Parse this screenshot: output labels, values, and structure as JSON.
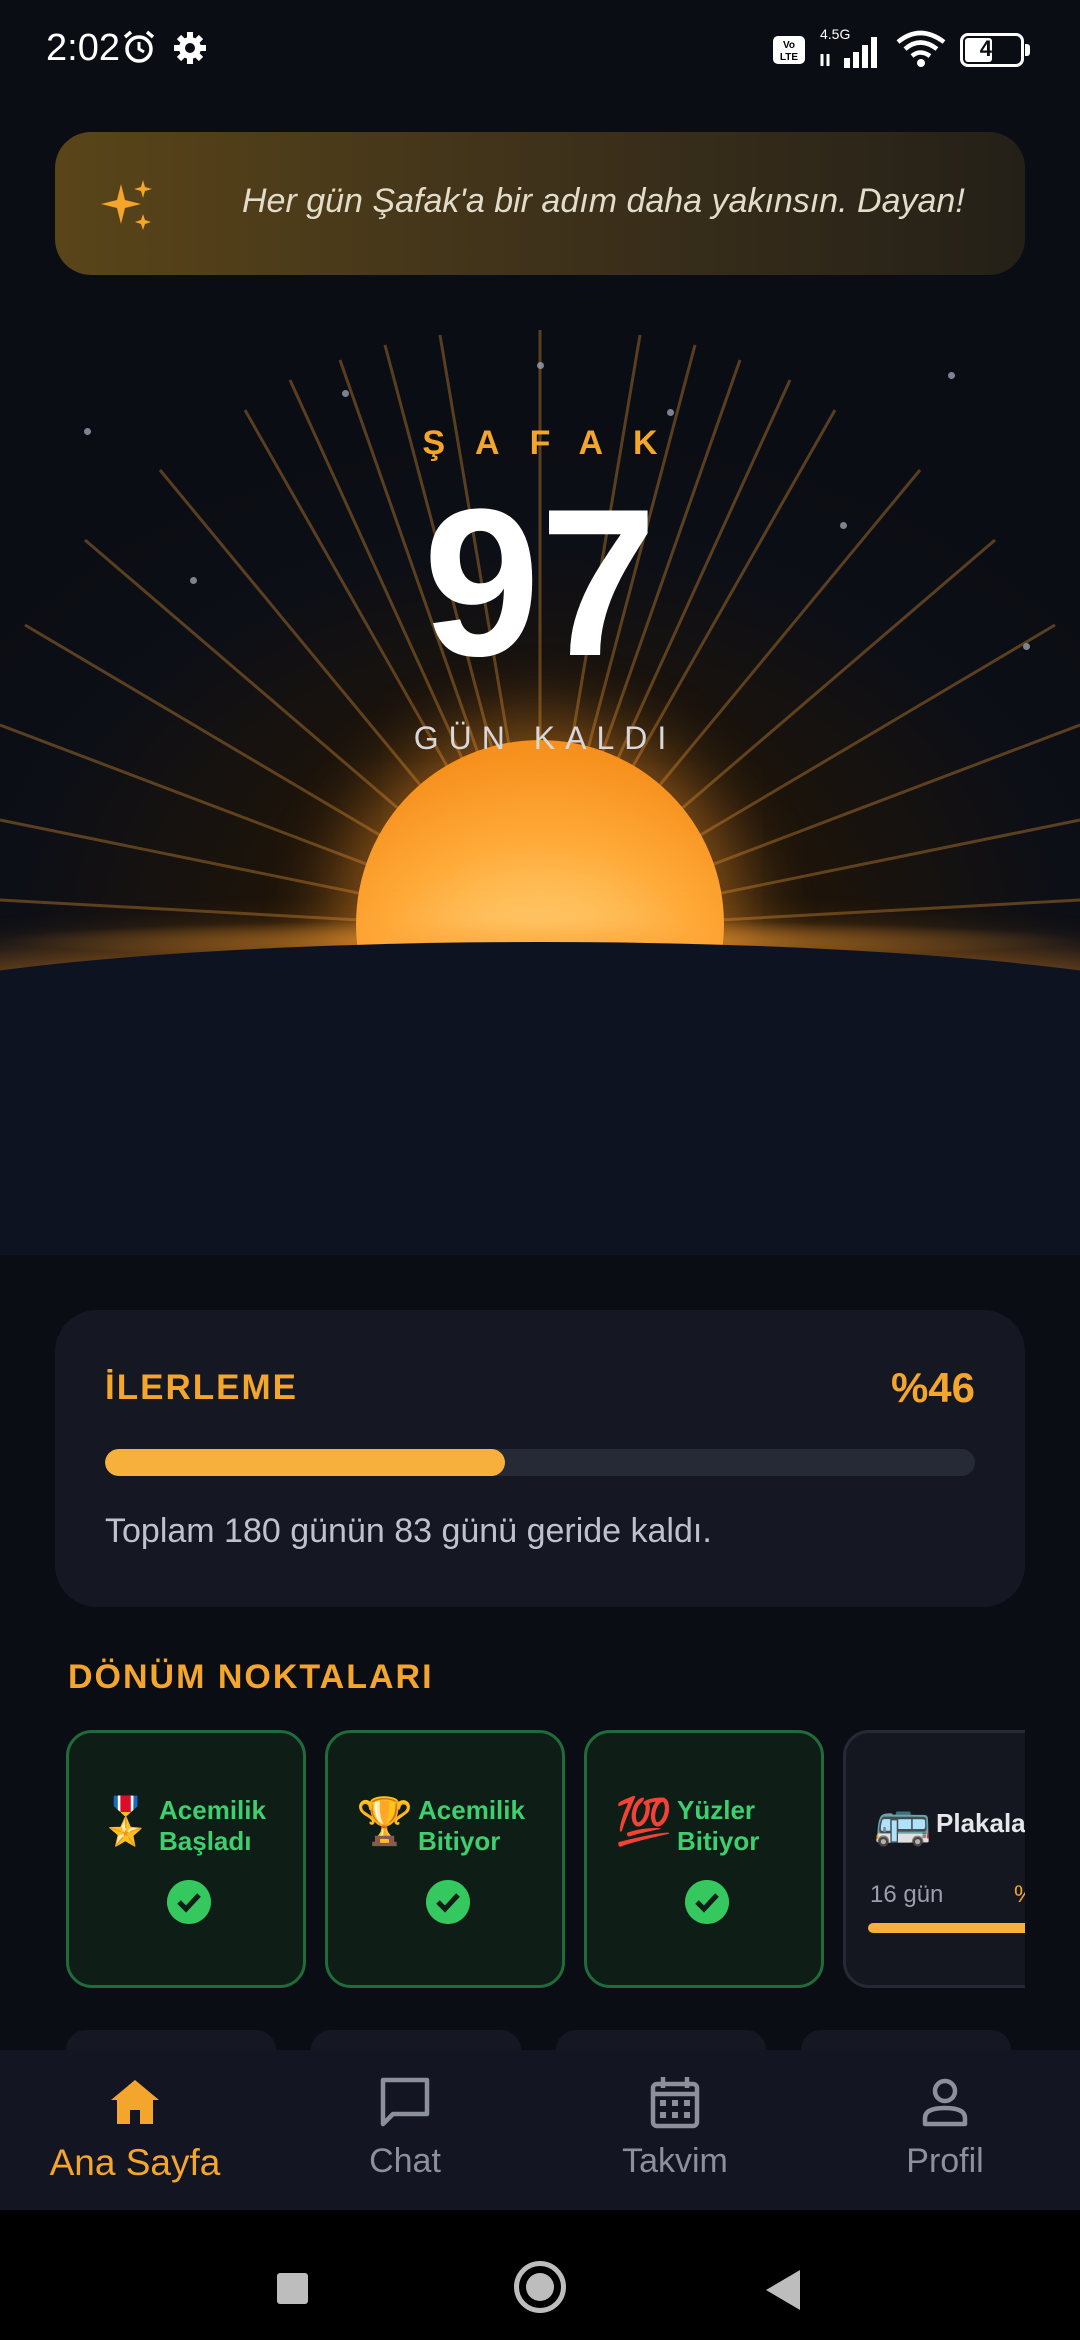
{
  "status_bar": {
    "time": "2:02",
    "network": "4.5G",
    "volte": "Vo LTE",
    "battery": "41"
  },
  "quote": {
    "text": "Her gün Şafak'a bir adım daha yakınsın. Dayan!",
    "icon": "sparkles-icon"
  },
  "countdown": {
    "label": "ŞAFAK",
    "days": "97",
    "sub_label": "GÜN KALDI"
  },
  "progress": {
    "title": "İLERLEME",
    "percent_text": "%46",
    "percent": 46,
    "description": "Toplam 180 günün 83 günü geride kaldı."
  },
  "milestones": {
    "title": "DÖNÜM NOKTALARI",
    "items": [
      {
        "emoji": "🎖️",
        "label": "Acemilik Başladı",
        "done": true
      },
      {
        "emoji": "🏆",
        "label": "Acemilik Bitiyor",
        "done": true
      },
      {
        "emoji": "💯",
        "label": "Yüzler Bitiyor",
        "done": true
      },
      {
        "emoji": "🚌",
        "label": "Plakalar",
        "done": false,
        "days_left": "16 gün",
        "percent": "%"
      }
    ]
  },
  "nav": {
    "items": [
      {
        "label": "Ana Sayfa",
        "icon": "home-icon",
        "active": true
      },
      {
        "label": "Chat",
        "icon": "chat-icon",
        "active": false
      },
      {
        "label": "Takvim",
        "icon": "calendar-icon",
        "active": false
      },
      {
        "label": "Profil",
        "icon": "person-icon",
        "active": false
      }
    ]
  },
  "colors": {
    "accent": "#f4a52c",
    "success": "#35c85f",
    "background": "#0b0d14",
    "card": "#151822"
  }
}
